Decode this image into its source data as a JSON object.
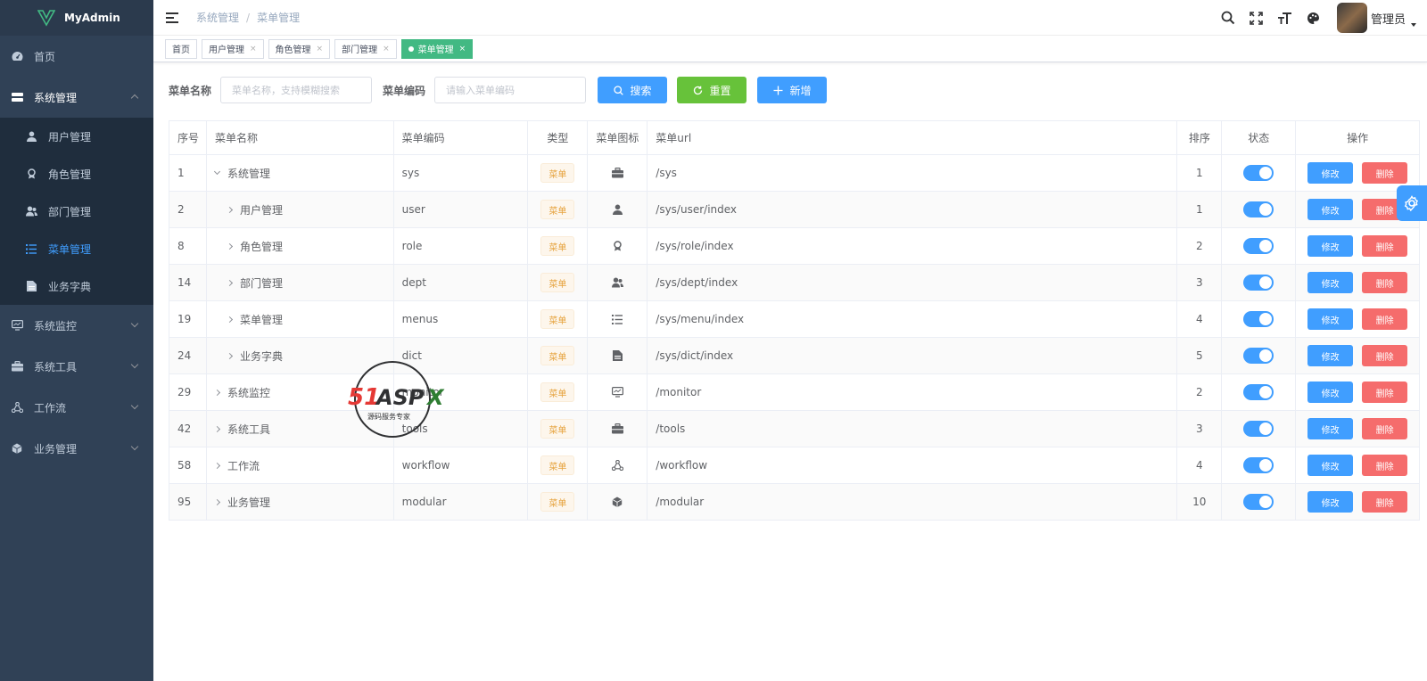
{
  "app": {
    "title": "MyAdmin"
  },
  "sidebar": {
    "items": [
      {
        "label": "首页",
        "icon": "dashboard-icon"
      },
      {
        "label": "系统管理",
        "icon": "system-icon",
        "open": true,
        "children": [
          {
            "label": "用户管理",
            "icon": "user-icon"
          },
          {
            "label": "角色管理",
            "icon": "role-icon"
          },
          {
            "label": "部门管理",
            "icon": "dept-icon"
          },
          {
            "label": "菜单管理",
            "icon": "list-icon",
            "active": true
          },
          {
            "label": "业务字典",
            "icon": "dict-icon"
          }
        ]
      },
      {
        "label": "系统监控",
        "icon": "monitor-icon"
      },
      {
        "label": "系统工具",
        "icon": "tools-icon"
      },
      {
        "label": "工作流",
        "icon": "workflow-icon"
      },
      {
        "label": "业务管理",
        "icon": "cube-icon"
      }
    ]
  },
  "header": {
    "breadcrumb": [
      "系统管理",
      "菜单管理"
    ],
    "username": "管理员"
  },
  "tags": [
    {
      "label": "首页"
    },
    {
      "label": "用户管理",
      "closable": true
    },
    {
      "label": "角色管理",
      "closable": true
    },
    {
      "label": "部门管理",
      "closable": true
    },
    {
      "label": "菜单管理",
      "closable": true,
      "active": true
    }
  ],
  "search": {
    "name_label": "菜单名称",
    "name_placeholder": "菜单名称，支持模糊搜索",
    "code_label": "菜单编码",
    "code_placeholder": "请输入菜单编码",
    "search_btn": "搜索",
    "reset_btn": "重置",
    "add_btn": "新增"
  },
  "table": {
    "columns": [
      "序号",
      "菜单名称",
      "菜单编码",
      "类型",
      "菜单图标",
      "菜单url",
      "排序",
      "状态",
      "操作"
    ],
    "rows": [
      {
        "id": "1",
        "name": "系统管理",
        "code": "sys",
        "type": "菜单",
        "icon": "briefcase-icon",
        "url": "/sys",
        "sort": "1",
        "level": 0,
        "expanded": true
      },
      {
        "id": "2",
        "name": "用户管理",
        "code": "user",
        "type": "菜单",
        "icon": "user-icon",
        "url": "/sys/user/index",
        "sort": "1",
        "level": 1
      },
      {
        "id": "8",
        "name": "角色管理",
        "code": "role",
        "type": "菜单",
        "icon": "role-icon",
        "url": "/sys/role/index",
        "sort": "2",
        "level": 1
      },
      {
        "id": "14",
        "name": "部门管理",
        "code": "dept",
        "type": "菜单",
        "icon": "dept-icon",
        "url": "/sys/dept/index",
        "sort": "3",
        "level": 1
      },
      {
        "id": "19",
        "name": "菜单管理",
        "code": "menus",
        "type": "菜单",
        "icon": "list-icon",
        "url": "/sys/menu/index",
        "sort": "4",
        "level": 1
      },
      {
        "id": "24",
        "name": "业务字典",
        "code": "dict",
        "type": "菜单",
        "icon": "dict-icon",
        "url": "/sys/dict/index",
        "sort": "5",
        "level": 1
      },
      {
        "id": "29",
        "name": "系统监控",
        "code": "monitor",
        "type": "菜单",
        "icon": "monitor-icon",
        "url": "/monitor",
        "sort": "2",
        "level": 0
      },
      {
        "id": "42",
        "name": "系统工具",
        "code": "tools",
        "type": "菜单",
        "icon": "briefcase-icon",
        "url": "/tools",
        "sort": "3",
        "level": 0
      },
      {
        "id": "58",
        "name": "工作流",
        "code": "workflow",
        "type": "菜单",
        "icon": "workflow-icon",
        "url": "/workflow",
        "sort": "4",
        "level": 0
      },
      {
        "id": "95",
        "name": "业务管理",
        "code": "modular",
        "type": "菜单",
        "icon": "cube-icon",
        "url": "/modular",
        "sort": "10",
        "level": 0
      }
    ],
    "edit_label": "修改",
    "delete_label": "删除"
  },
  "watermark": {
    "brand": "51ASPX",
    "tagline": "源码服务专家"
  },
  "colors": {
    "primary": "#409eff",
    "success": "#67c23a",
    "danger": "#f56c6c",
    "sidebar": "#304156",
    "tag_active": "#42b983"
  }
}
